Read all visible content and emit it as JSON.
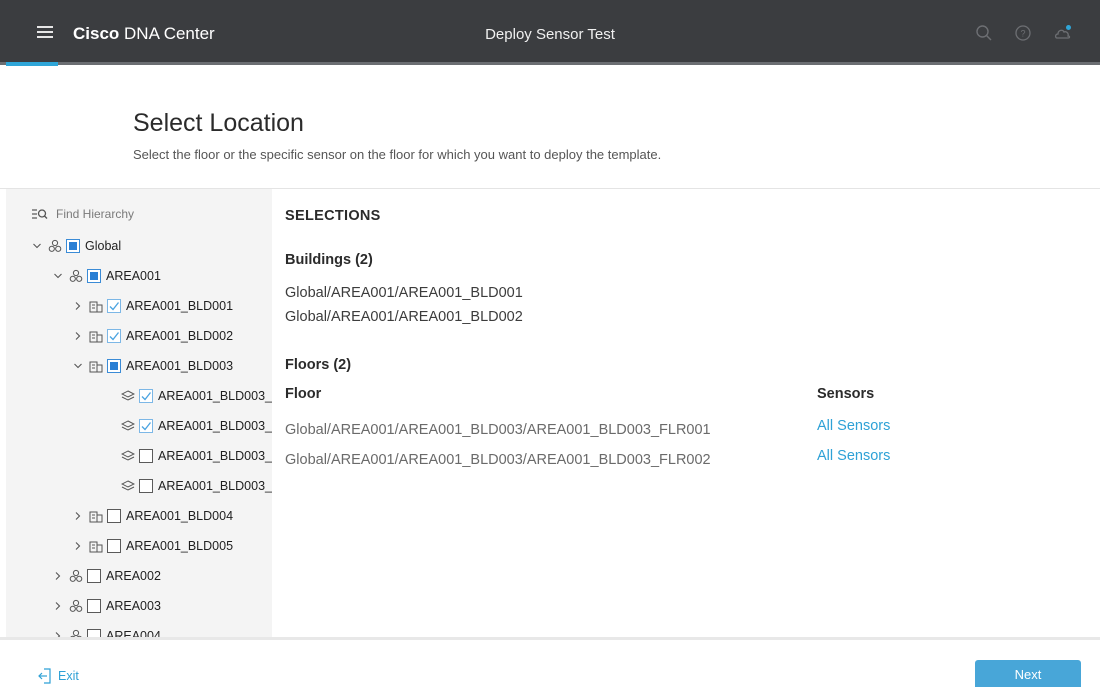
{
  "topbar": {
    "brand_bold": "Cisco",
    "brand_rest": " DNA Center",
    "title": "Deploy Sensor Test",
    "icons": [
      "search-icon",
      "help-icon",
      "cloud-notification-icon"
    ]
  },
  "header": {
    "title": "Select Location",
    "subtitle": "Select the floor or the specific sensor on the floor for which you want to deploy the template."
  },
  "sidebar": {
    "search_placeholder": "Find Hierarchy",
    "tree": [
      {
        "label": "Global",
        "level": 0,
        "expand": "expanded",
        "icon": "site",
        "check": "partial"
      },
      {
        "label": "AREA001",
        "level": 1,
        "expand": "expanded",
        "icon": "site",
        "check": "partial"
      },
      {
        "label": "AREA001_BLD001",
        "level": 2,
        "expand": "collapsed",
        "icon": "building",
        "check": "checked"
      },
      {
        "label": "AREA001_BLD002",
        "level": 2,
        "expand": "collapsed",
        "icon": "building",
        "check": "checked"
      },
      {
        "label": "AREA001_BLD003",
        "level": 2,
        "expand": "expanded",
        "icon": "building",
        "check": "partial"
      },
      {
        "label": "AREA001_BLD003_",
        "level": 3,
        "expand": "none",
        "icon": "floor",
        "check": "checked"
      },
      {
        "label": "AREA001_BLD003_",
        "level": 3,
        "expand": "none",
        "icon": "floor",
        "check": "checked"
      },
      {
        "label": "AREA001_BLD003_",
        "level": 3,
        "expand": "none",
        "icon": "floor",
        "check": "unchecked"
      },
      {
        "label": "AREA001_BLD003_",
        "level": 3,
        "expand": "none",
        "icon": "floor",
        "check": "unchecked"
      },
      {
        "label": "AREA001_BLD004",
        "level": 2,
        "expand": "collapsed",
        "icon": "building",
        "check": "unchecked"
      },
      {
        "label": "AREA001_BLD005",
        "level": 2,
        "expand": "collapsed",
        "icon": "building",
        "check": "unchecked"
      },
      {
        "label": "AREA002",
        "level": 1,
        "expand": "collapsed",
        "icon": "site",
        "check": "unchecked"
      },
      {
        "label": "AREA003",
        "level": 1,
        "expand": "collapsed",
        "icon": "site",
        "check": "unchecked"
      },
      {
        "label": "AREA004",
        "level": 1,
        "expand": "collapsed",
        "icon": "site",
        "check": "unchecked"
      }
    ]
  },
  "selections": {
    "title": "SELECTIONS",
    "buildings_heading": "Buildings (2)",
    "buildings": [
      "Global/AREA001/AREA001_BLD001",
      "Global/AREA001/AREA001_BLD002"
    ],
    "floors_heading": "Floors (2)",
    "floor_col": "Floor",
    "sensors_col": "Sensors",
    "floors": [
      {
        "path": "Global/AREA001/AREA001_BLD003/AREA001_BLD003_FLR001",
        "sensors": "All Sensors"
      },
      {
        "path": "Global/AREA001/AREA001_BLD003/AREA001_BLD003_FLR002",
        "sensors": "All Sensors"
      }
    ]
  },
  "footer": {
    "exit_label": "Exit",
    "next_label": "Next"
  },
  "colors": {
    "topbar_bg": "#3b3d40",
    "accent": "#2fa6d8",
    "link": "#2ea1d6",
    "checkbox_partial": "#2a7fd4",
    "sidebar_bg": "#f4f4f4"
  }
}
